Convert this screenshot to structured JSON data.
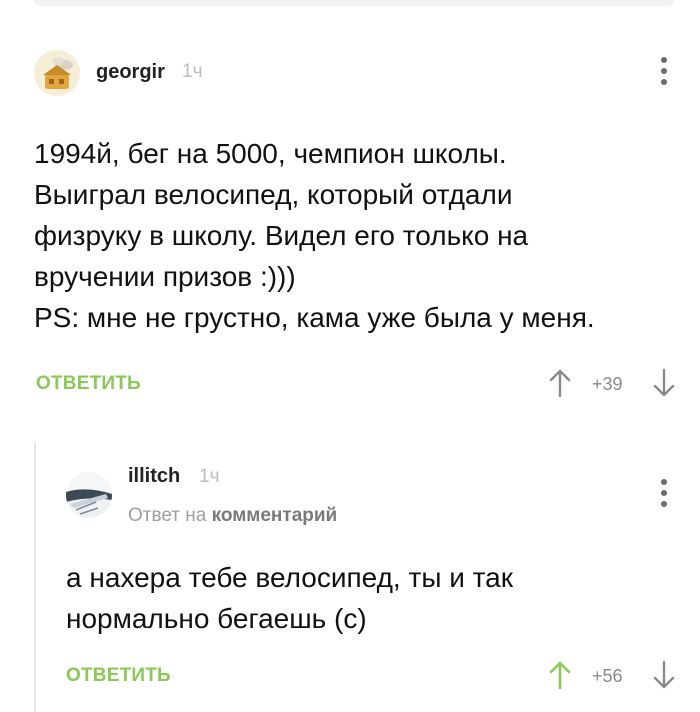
{
  "comments": [
    {
      "author": "georgir",
      "time": "1ч",
      "lines": [
        "1994й, бег на 5000, чемпион школы.",
        "Выиграл велосипед, который отдали",
        "физруку в школу. Видел его только на",
        "вручении призов :)))",
        "PS: мне не грустно, кама уже была у меня."
      ],
      "reply_label": "ОТВЕТИТЬ",
      "rating": "+39"
    },
    {
      "author": "illitch",
      "time": "1ч",
      "reply_prefix": "Ответ на",
      "reply_target": "комментарий",
      "lines": [
        "а нахера тебе велосипед, ты и так",
        "нормально бегаешь (с)"
      ],
      "reply_label": "ОТВЕТИТЬ",
      "rating": "+56"
    }
  ],
  "colors": {
    "accent": "#8ac858",
    "muted": "#8a8a8a",
    "thread_line": "#e7e7e7"
  },
  "icons": [
    "more-vertical-icon",
    "arrow-up-icon",
    "arrow-down-icon"
  ]
}
